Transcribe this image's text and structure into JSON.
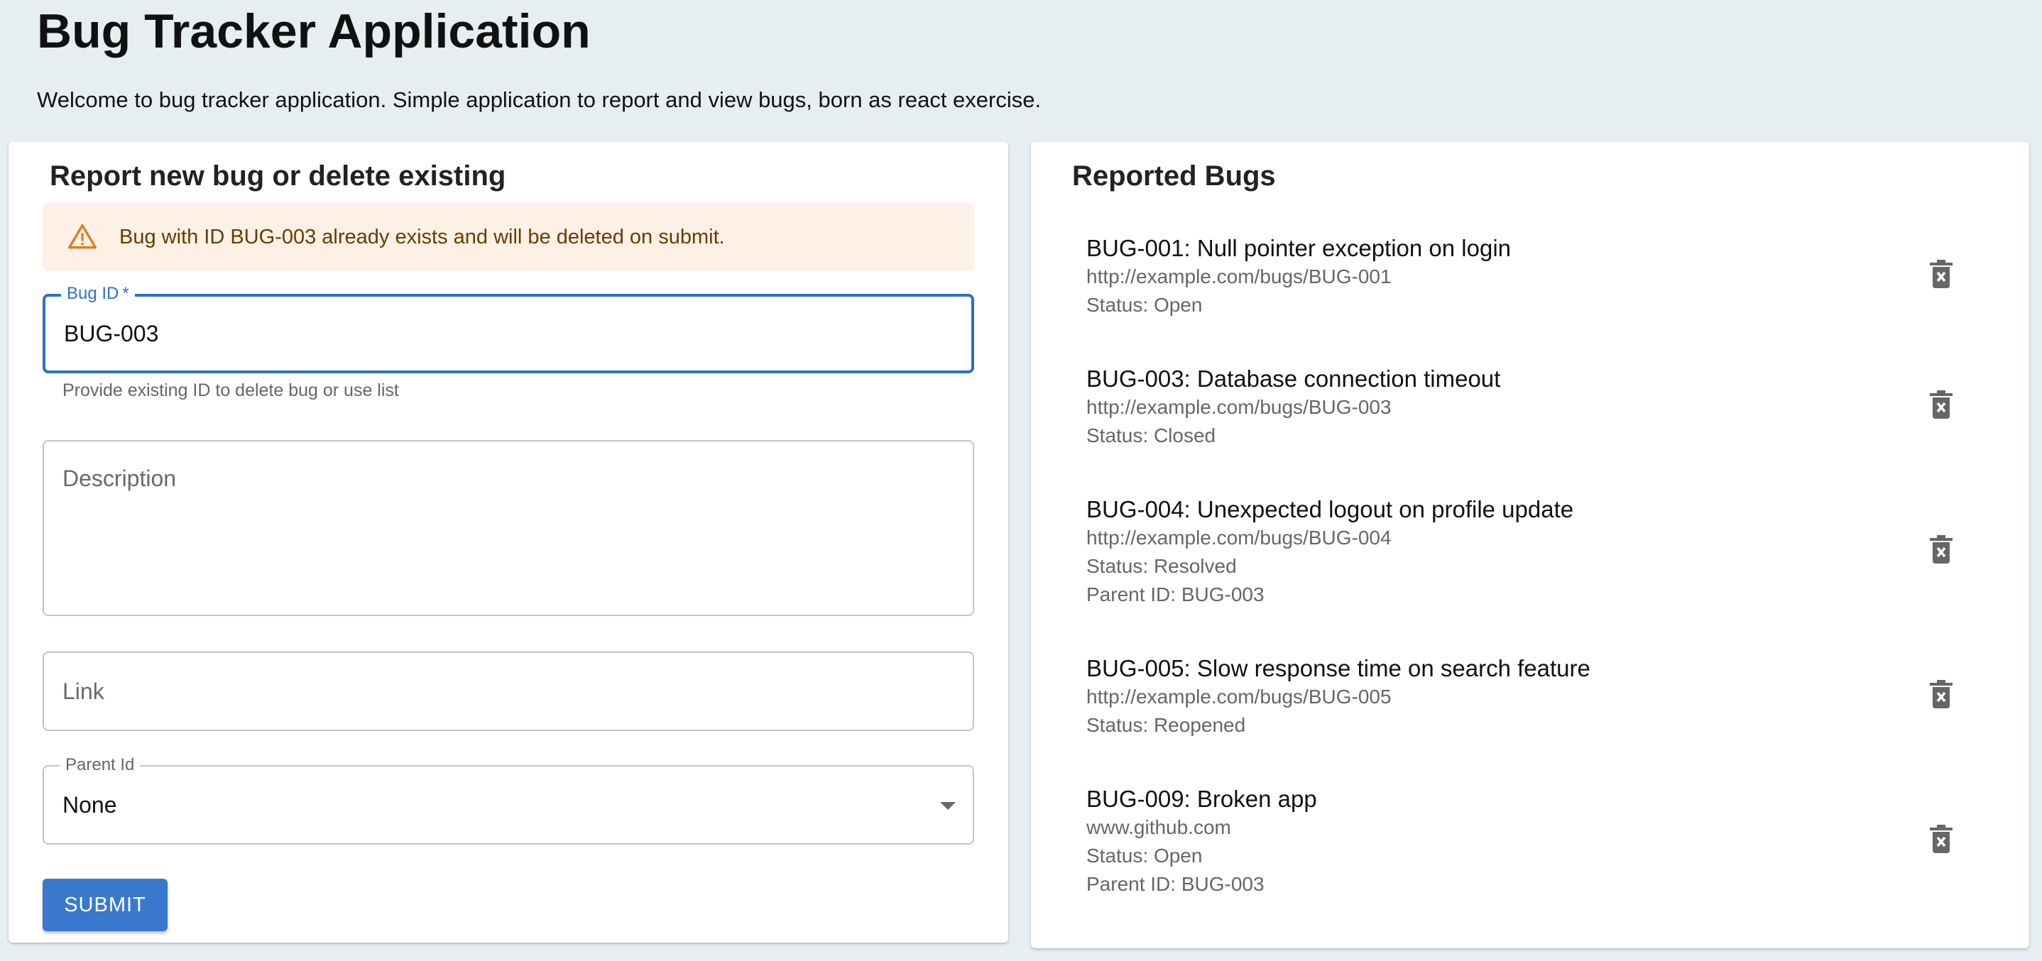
{
  "app": {
    "title": "Bug Tracker Application",
    "subtitle": "Welcome to bug tracker application. Simple application to report and view bugs, born as react exercise."
  },
  "form": {
    "title": "Report new bug or delete existing",
    "alert": {
      "text": "Bug with ID BUG-003 already exists and will be deleted on submit.",
      "icon": "warning-icon"
    },
    "bug_id": {
      "label": "Bug ID",
      "required_mark": "*",
      "value": "BUG-003",
      "helper": "Provide existing ID to delete bug or use list"
    },
    "description": {
      "placeholder": "Description",
      "value": ""
    },
    "link": {
      "placeholder": "Link",
      "value": ""
    },
    "parent_id": {
      "label": "Parent Id",
      "value": "None"
    },
    "submit_label": "SUBMIT"
  },
  "list": {
    "title": "Reported Bugs",
    "bugs": [
      {
        "title": "BUG-001: Null pointer exception on login",
        "link": "http://example.com/bugs/BUG-001",
        "status": "Status: Open",
        "parent": ""
      },
      {
        "title": "BUG-003: Database connection timeout",
        "link": "http://example.com/bugs/BUG-003",
        "status": "Status: Closed",
        "parent": ""
      },
      {
        "title": "BUG-004: Unexpected logout on profile update",
        "link": "http://example.com/bugs/BUG-004",
        "status": "Status: Resolved",
        "parent": "Parent ID: BUG-003"
      },
      {
        "title": "BUG-005: Slow response time on search feature",
        "link": "http://example.com/bugs/BUG-005",
        "status": "Status: Reopened",
        "parent": ""
      },
      {
        "title": "BUG-009: Broken app",
        "link": "www.github.com",
        "status": "Status: Open",
        "parent": "Parent ID: BUG-003"
      }
    ]
  },
  "colors": {
    "primary": "#2f6fc4",
    "button": "#3a78cd",
    "alert_bg": "#fdf1e5",
    "alert_text": "#663c00",
    "page_bg": "#e7eef2"
  }
}
